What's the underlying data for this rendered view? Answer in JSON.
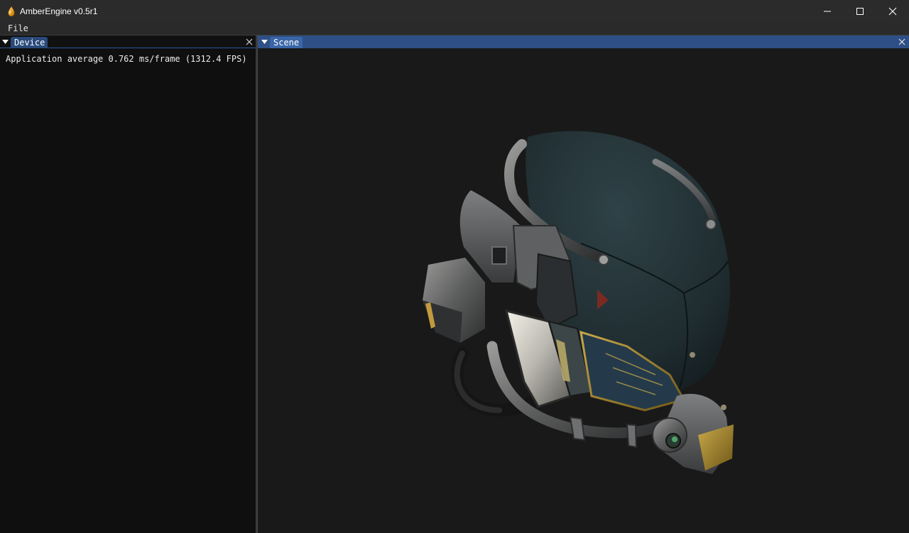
{
  "window": {
    "title": "AmberEngine v0.5r1",
    "app_icon": "amber-drop-icon",
    "controls": [
      "minimize-icon",
      "maximize-icon",
      "close-icon"
    ]
  },
  "menu": {
    "items": [
      {
        "label": "File"
      }
    ]
  },
  "device_panel": {
    "tab_label": "Device",
    "stats_text": "Application average 0.762 ms/frame (1312.4 FPS)"
  },
  "scene_panel": {
    "tab_label": "Scene",
    "viewport_content": "3d-helmet-model"
  },
  "colors": {
    "titlebar_bg": "#2b2b2b",
    "menubar_bg": "#2a2a2a",
    "panel_bg": "#0f0f0f",
    "viewport_bg": "#191919",
    "active_tab": "#3a66a8",
    "active_tabbar": "#2d4f85",
    "inactive_tab": "#294a7a",
    "text": "#e6e6e6"
  }
}
